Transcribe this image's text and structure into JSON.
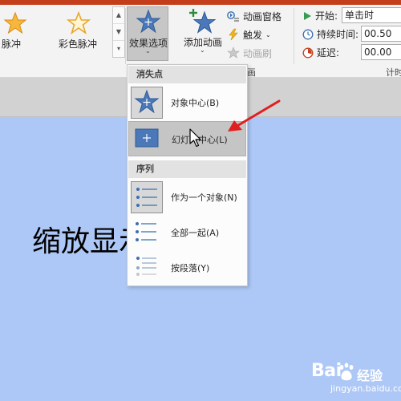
{
  "gallery": {
    "item1_label": "脉冲",
    "item2_label": "彩色脉冲",
    "scroll_up": "▲",
    "scroll_down": "▼",
    "scroll_more": "▾"
  },
  "effect_options": {
    "label": "效果选项",
    "caret": "⌄"
  },
  "add_animation": {
    "label": "添加动画",
    "caret": "⌄"
  },
  "advanced": {
    "animation_pane": "动画窗格",
    "trigger": "触发",
    "trigger_caret": "⌄",
    "animation_painter": "动画刷",
    "group_label": "画"
  },
  "timing": {
    "start_label": "开始:",
    "start_value": "单击时",
    "duration_label": "持续时间:",
    "duration_value": "00.50",
    "delay_label": "延迟:",
    "delay_value": "00.00",
    "group_label": "计时"
  },
  "menu": {
    "section1_header": "消失点",
    "item_object_center": "对象中心(B)",
    "item_slide_center": "幻灯片中心(L)",
    "section2_header": "序列",
    "item_as_one": "作为一个对象(N)",
    "item_all_at_once": "全部一起(A)",
    "item_by_paragraph": "按段落(Y)"
  },
  "slide": {
    "title": "缩放显示"
  },
  "watermark": {
    "brand": "Bai",
    "brand2": "经验",
    "url": "jingyan.baidu.com"
  },
  "colors": {
    "accent_red": "#c43e1c",
    "star_blue": "#4a78b8",
    "slide_bg": "#adc8f6",
    "arrow_red": "#e02020"
  }
}
